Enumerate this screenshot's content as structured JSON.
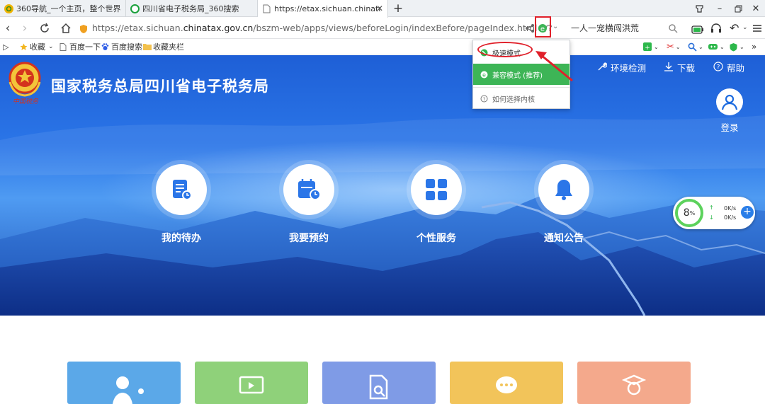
{
  "tabs": [
    {
      "title": "360导航_一个主页，整个世界"
    },
    {
      "title": "四川省电子税务局_360搜索"
    },
    {
      "title": "https://etax.sichuan.chinatax.g"
    }
  ],
  "address_bar": {
    "url_prefix": "https://etax.sichuan.",
    "url_domain": "chinatax.gov.cn",
    "url_suffix": "/bszm-web/apps/views/beforeLogin/indexBefore/pageIndex.html#/?_t=",
    "search_text": "一人一宠横闯洪荒"
  },
  "bookmarks": [
    {
      "label": "收藏"
    },
    {
      "label": "百度一下"
    },
    {
      "label": "百度搜索"
    },
    {
      "label": "收藏夹栏"
    }
  ],
  "kernel_menu": {
    "items": [
      {
        "label": "极速模式"
      },
      {
        "label": "兼容模式 (推荐)"
      },
      {
        "label": "如何选择内核"
      }
    ]
  },
  "site": {
    "title": "国家税务总局四川省电子税务局",
    "emblem_text": "中国税务",
    "header_links": [
      {
        "label": "环境检测"
      },
      {
        "label": "下载"
      },
      {
        "label": "帮助"
      }
    ],
    "login_label": "登录",
    "services": [
      {
        "label": "我的待办"
      },
      {
        "label": "我要预约"
      },
      {
        "label": "个性服务"
      },
      {
        "label": "通知公告"
      }
    ]
  },
  "speed_widget": {
    "percent": "8",
    "percent_unit": "%",
    "up": "0K/s",
    "down": "0K/s"
  },
  "colors": {
    "hero_blue": "#2b76e8",
    "compat_green": "#3db556",
    "annotation_red": "#e0202a",
    "card_colors": [
      "#5ba8e8",
      "#8fd17a",
      "#7f9be6",
      "#f2c45a",
      "#f4a98c"
    ]
  }
}
